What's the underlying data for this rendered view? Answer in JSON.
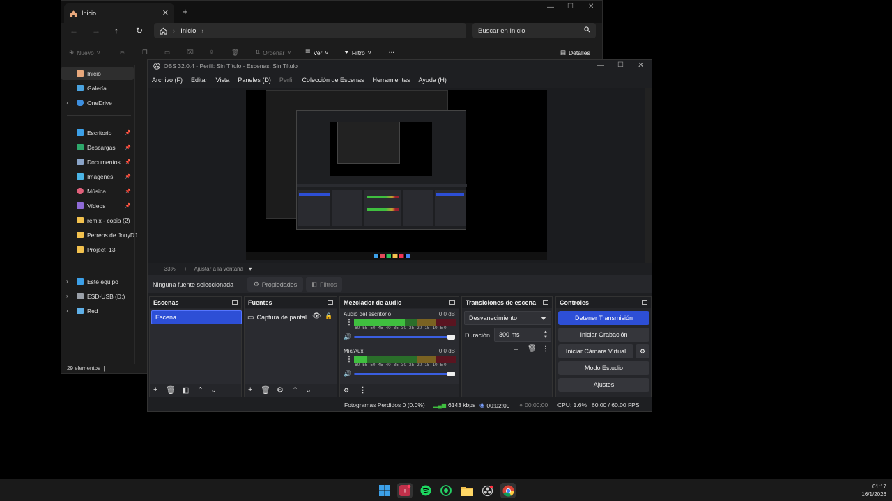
{
  "explorer": {
    "tab_title": "Inicio",
    "new_tab": "+",
    "breadcrumb": "Inicio",
    "search_placeholder": "Buscar en Inicio",
    "toolbar": {
      "nuevo": "Nuevo",
      "ordenar": "Ordenar",
      "ver": "Ver",
      "filtro": "Filtro",
      "detalles": "Detalles"
    },
    "sidebar": [
      {
        "label": "Inicio",
        "icon": "home-icon",
        "selected": true
      },
      {
        "label": "Galería",
        "icon": "gallery-icon"
      },
      {
        "label": "OneDrive",
        "icon": "cloud-icon",
        "expandable": true
      },
      {
        "label": "Escritorio",
        "icon": "desktop-icon",
        "pinned": true
      },
      {
        "label": "Descargas",
        "icon": "download-icon",
        "pinned": true
      },
      {
        "label": "Documentos",
        "icon": "document-icon",
        "pinned": true
      },
      {
        "label": "Imágenes",
        "icon": "image-icon",
        "pinned": true
      },
      {
        "label": "Música",
        "icon": "music-icon",
        "pinned": true
      },
      {
        "label": "Vídeos",
        "icon": "video-icon",
        "pinned": true
      },
      {
        "label": "remix - copia (2)",
        "icon": "folder-icon"
      },
      {
        "label": "Perreos de JonyDJ",
        "icon": "folder-icon"
      },
      {
        "label": "Project_13",
        "icon": "folder-icon"
      },
      {
        "label": "Este equipo",
        "icon": "computer-icon",
        "expandable": true
      },
      {
        "label": "ESD-USB (D:)",
        "icon": "drive-icon",
        "expandable": true
      },
      {
        "label": "Red",
        "icon": "network-icon",
        "expandable": true
      }
    ],
    "status": "29 elementos"
  },
  "obs": {
    "title": "OBS 32.0.4 - Perfil: Sin Título - Escenas: Sin Título",
    "menu": [
      "Archivo (F)",
      "Editar",
      "Vista",
      "Paneles (D)",
      "Perfil",
      "Colección de Escenas",
      "Herramientas",
      "Ayuda (H)"
    ],
    "zoom": {
      "minus": "−",
      "percent": "33%",
      "plus": "+",
      "fit": "Ajustar a la ventana"
    },
    "no_source": "Ninguna fuente seleccionada",
    "properties": "Propiedades",
    "filters": "Filtros",
    "docks": {
      "scenes": {
        "title": "Escenas",
        "items": [
          "Escena"
        ]
      },
      "sources": {
        "title": "Fuentes",
        "items": [
          "Captura de pantalla"
        ]
      },
      "mixer": {
        "title": "Mezclador de audio",
        "ticks": "-60 -55 -50 -45 -40 -35 -30 -25 -20 -15 -10 -5 0",
        "channels": [
          {
            "name": "Audio del escritorio",
            "db": "0.0 dB",
            "level": 0.5,
            "volume": 1.0
          },
          {
            "name": "Mic/Aux",
            "db": "0.0 dB",
            "level": 0.13,
            "volume": 1.0
          }
        ]
      },
      "transitions": {
        "title": "Transiciones de escena",
        "selected": "Desvanecimiento",
        "duration_label": "Duración",
        "duration": "300 ms"
      },
      "controls": {
        "title": "Controles",
        "stop_stream": "Detener Transmisión",
        "start_record": "Iniciar Grabación",
        "virtual_cam": "Iniciar Cámara Virtual",
        "studio_mode": "Modo Estudio",
        "settings": "Ajustes"
      }
    },
    "status": {
      "dropped": "Fotogramas Perdidos 0 (0.0%)",
      "bitrate": "6143 kbps",
      "stream_time": "00:02:09",
      "rec_time": "00:00:00",
      "cpu": "CPU: 1.6%",
      "fps": "60.00 / 60.00 FPS"
    }
  },
  "taskbar": {
    "apps": [
      "windows-start-icon",
      "obs-icon",
      "spotify-icon",
      "whatsapp-icon",
      "file-explorer-icon",
      "obs-studio-alt-icon",
      "chrome-icon"
    ],
    "time": "01:17",
    "date": "16/1/2026"
  },
  "colors": {
    "accent": "#2d4fd6",
    "meter_green": "#3fbf3f",
    "meter_yellow": "#c8a030",
    "meter_red": "#9b1e2e"
  }
}
